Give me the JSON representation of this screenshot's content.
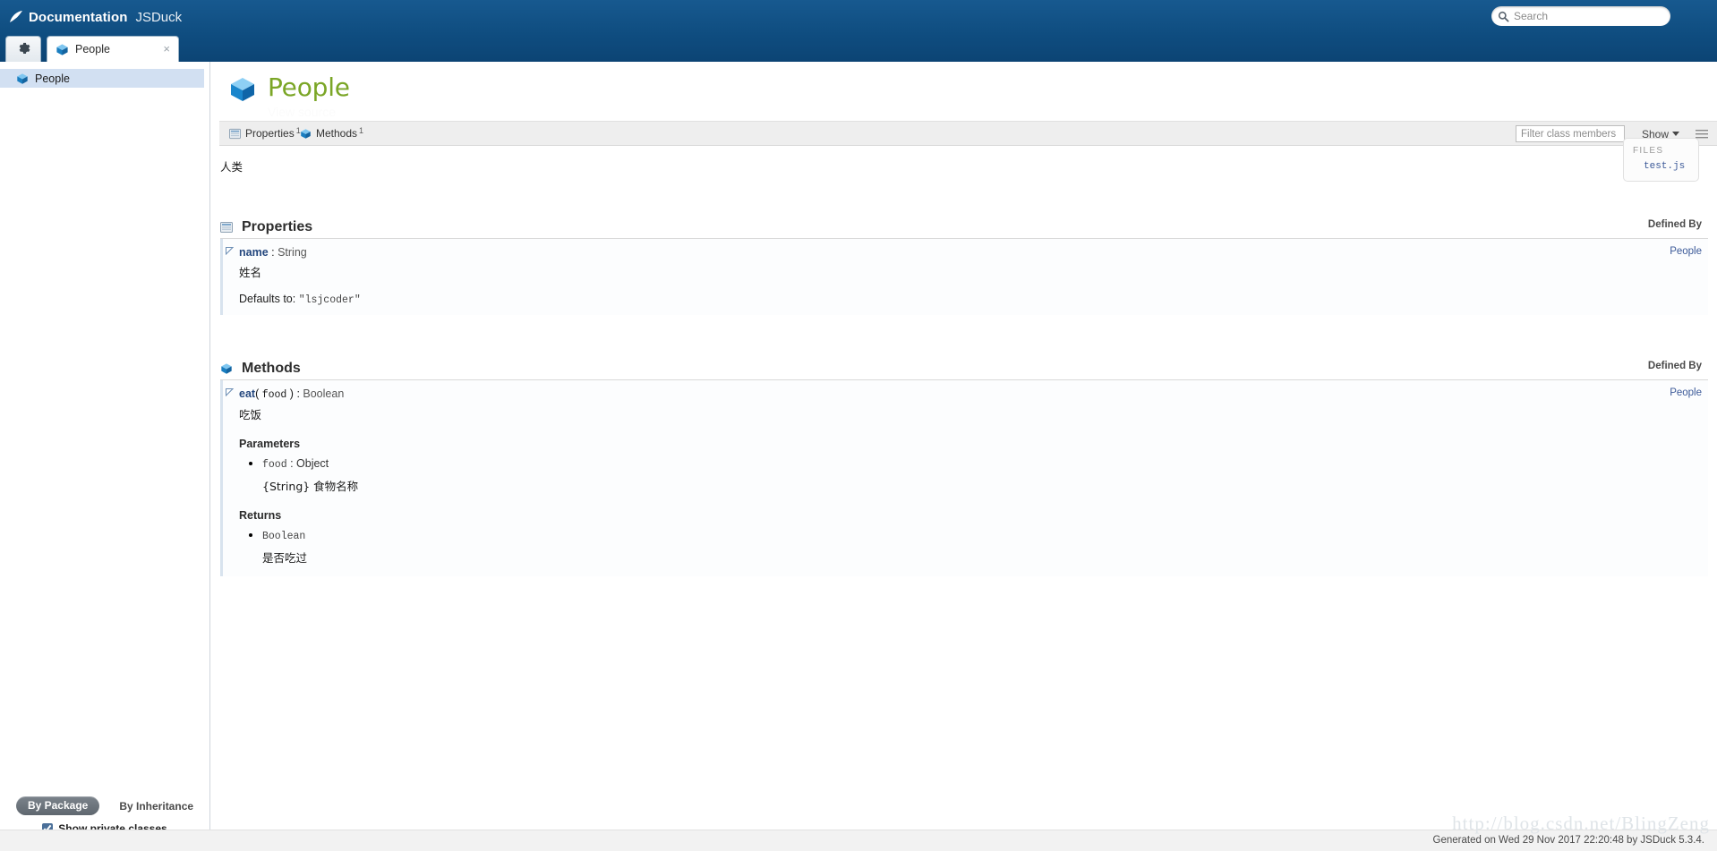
{
  "header": {
    "logo_icon": "feather-logo-icon",
    "title": "Documentation",
    "subtitle": "JSDuck",
    "search_placeholder": "Search",
    "search_value": "",
    "expand_chevrons": "»"
  },
  "tabs": [
    {
      "id": "settings",
      "icon": "gear-icon",
      "label": ""
    },
    {
      "id": "people",
      "icon": "class-cube-icon",
      "label": "People",
      "close": "×",
      "active": true
    }
  ],
  "sidebar": {
    "tree": [
      {
        "icon": "class-cube-icon",
        "label": "People",
        "selected": true
      }
    ],
    "footer": {
      "by_package": "By Package",
      "by_inheritance": "By Inheritance",
      "show_private": "Show private classes",
      "show_private_checked": true
    }
  },
  "main": {
    "class_icon": "class-cube-icon",
    "class_name": "People",
    "view_source": "View source",
    "toolbar": {
      "properties_label": "Properties",
      "properties_count": "1",
      "methods_label": "Methods",
      "methods_count": "1",
      "filter_placeholder": "Filter class members",
      "filter_value": "",
      "show_label": "Show",
      "expand_all_icon": "hamburger-lines-icon"
    },
    "class_doc": "人类",
    "files_box": {
      "title": "FILES",
      "file": "test.js"
    },
    "defined_by_label": "Defined By",
    "sections": [
      {
        "id": "properties",
        "icon": "property-icon",
        "title": "Properties",
        "members": [
          {
            "name": "name",
            "separator": " : ",
            "type": "String",
            "owner": "People",
            "description": "姓名",
            "defaults_label": "Defaults to: ",
            "defaults_value": "\"lsjcoder\""
          }
        ]
      },
      {
        "id": "methods",
        "icon": "method-cube-icon",
        "title": "Methods",
        "members": [
          {
            "name": "eat",
            "paren_open": "( ",
            "args": "food",
            "paren_close": " )",
            "separator": " : ",
            "type": "Boolean",
            "owner": "People",
            "description": "吃饭",
            "parameters_title": "Parameters",
            "parameters": [
              {
                "name": "food",
                "separator": " : ",
                "type": "Object",
                "description": "{String} 食物名称"
              }
            ],
            "returns_title": "Returns",
            "returns": [
              {
                "type": "Boolean",
                "description": "是否吃过"
              }
            ]
          }
        ]
      }
    ]
  },
  "footer": {
    "generated_text": "Generated on Wed 29 Nov 2017 22:20:48 by JSDuck 5.3.4.",
    "watermark": "http://blog.csdn.net/BlingZeng"
  }
}
